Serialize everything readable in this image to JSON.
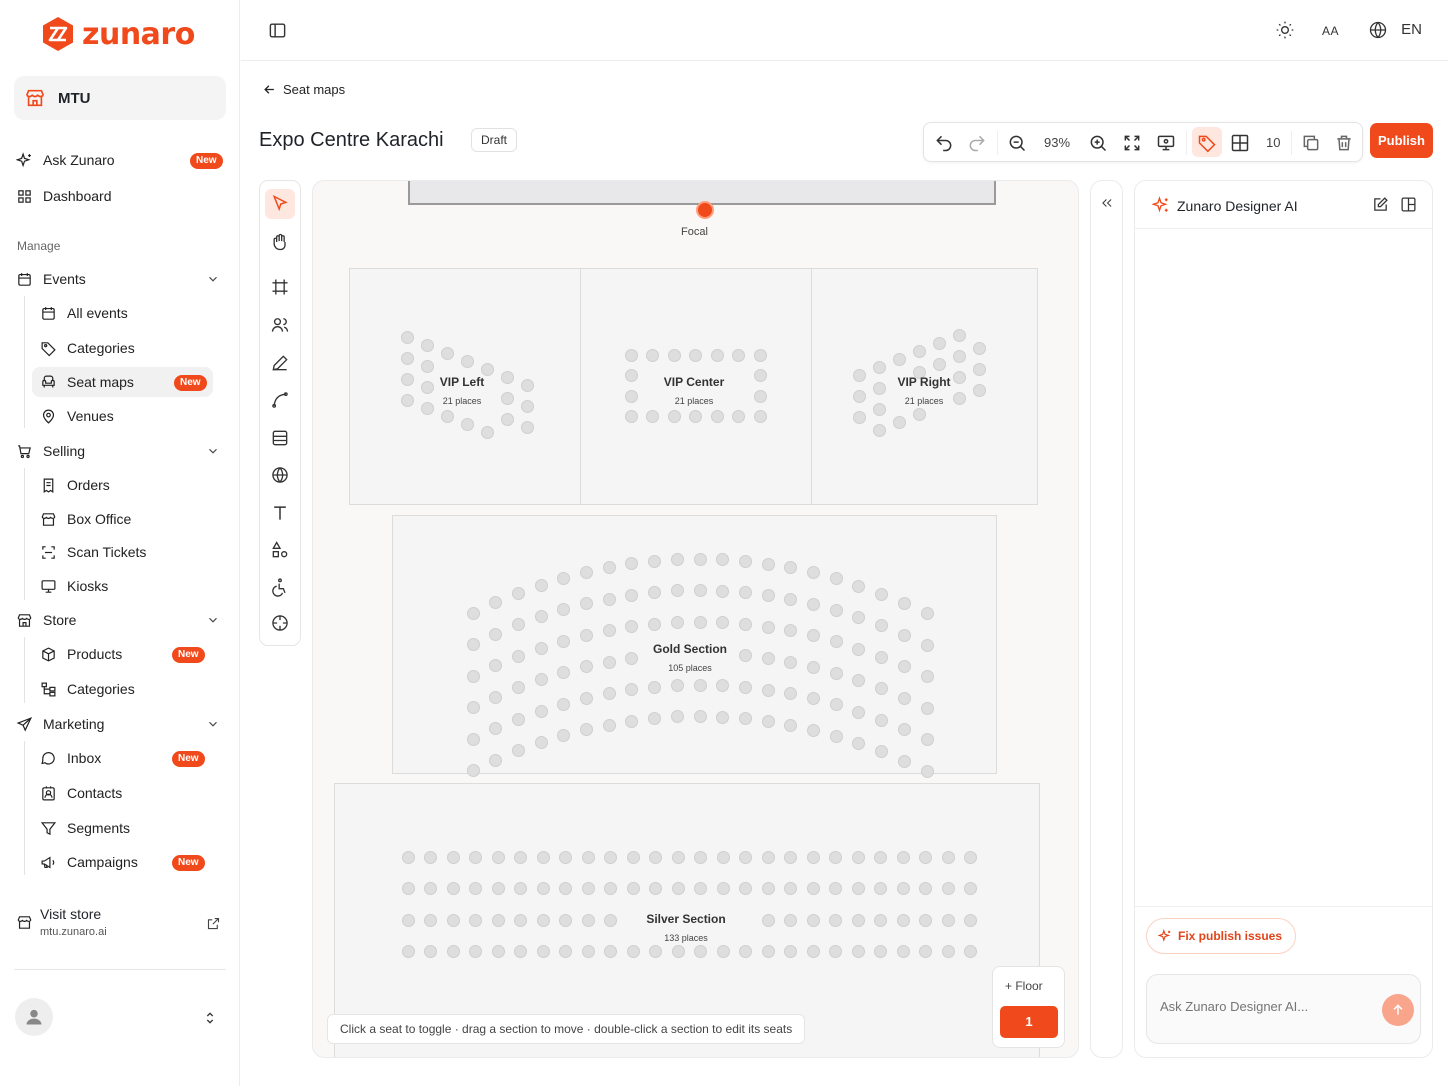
{
  "brand": {
    "name": "zunaro",
    "accent": "#f04a1c"
  },
  "org": {
    "name": "MTU",
    "icon": "store-icon"
  },
  "nav": {
    "ask": {
      "label": "Ask Zunaro",
      "badge": "New"
    },
    "dashboard": {
      "label": "Dashboard"
    },
    "manage_label": "Manage",
    "events": {
      "label": "Events",
      "items": [
        {
          "label": "All events"
        },
        {
          "label": "Categories"
        },
        {
          "label": "Seat maps",
          "badge": "New"
        },
        {
          "label": "Venues"
        }
      ]
    },
    "selling": {
      "label": "Selling",
      "items": [
        {
          "label": "Orders"
        },
        {
          "label": "Box Office"
        },
        {
          "label": "Scan Tickets"
        },
        {
          "label": "Kiosks"
        }
      ]
    },
    "store": {
      "label": "Store",
      "items": [
        {
          "label": "Products",
          "badge": "New"
        },
        {
          "label": "Categories"
        }
      ]
    },
    "marketing": {
      "label": "Marketing",
      "items": [
        {
          "label": "Inbox",
          "badge": "New"
        },
        {
          "label": "Contacts"
        },
        {
          "label": "Segments"
        },
        {
          "label": "Campaigns",
          "badge": "New"
        }
      ]
    },
    "visit": {
      "title": "Visit store",
      "url": "mtu.zunaro.ai"
    }
  },
  "header": {
    "aa": "AA",
    "lang": "EN"
  },
  "page": {
    "back_label": "Seat maps",
    "title": "Expo Centre Karachi",
    "status": "Draft"
  },
  "toolbar": {
    "zoom": "93%",
    "grid_size": "10",
    "publish": "Publish"
  },
  "canvas": {
    "focal": "Focal",
    "sections": [
      {
        "name": "VIP Left",
        "places": "21 places"
      },
      {
        "name": "VIP Center",
        "places": "21 places"
      },
      {
        "name": "VIP Right",
        "places": "21 places"
      },
      {
        "name": "Gold Section",
        "places": "105 places"
      },
      {
        "name": "Silver Section",
        "places": "133 places"
      }
    ],
    "hint": "Click a seat to toggle · drag a section to move · double-click a section to edit its seats",
    "floor_add": "+ Floor",
    "floor_current": "1"
  },
  "ai": {
    "title": "Zunaro Designer AI",
    "fix_label": "Fix publish issues",
    "placeholder": "Ask Zunaro Designer AI..."
  }
}
